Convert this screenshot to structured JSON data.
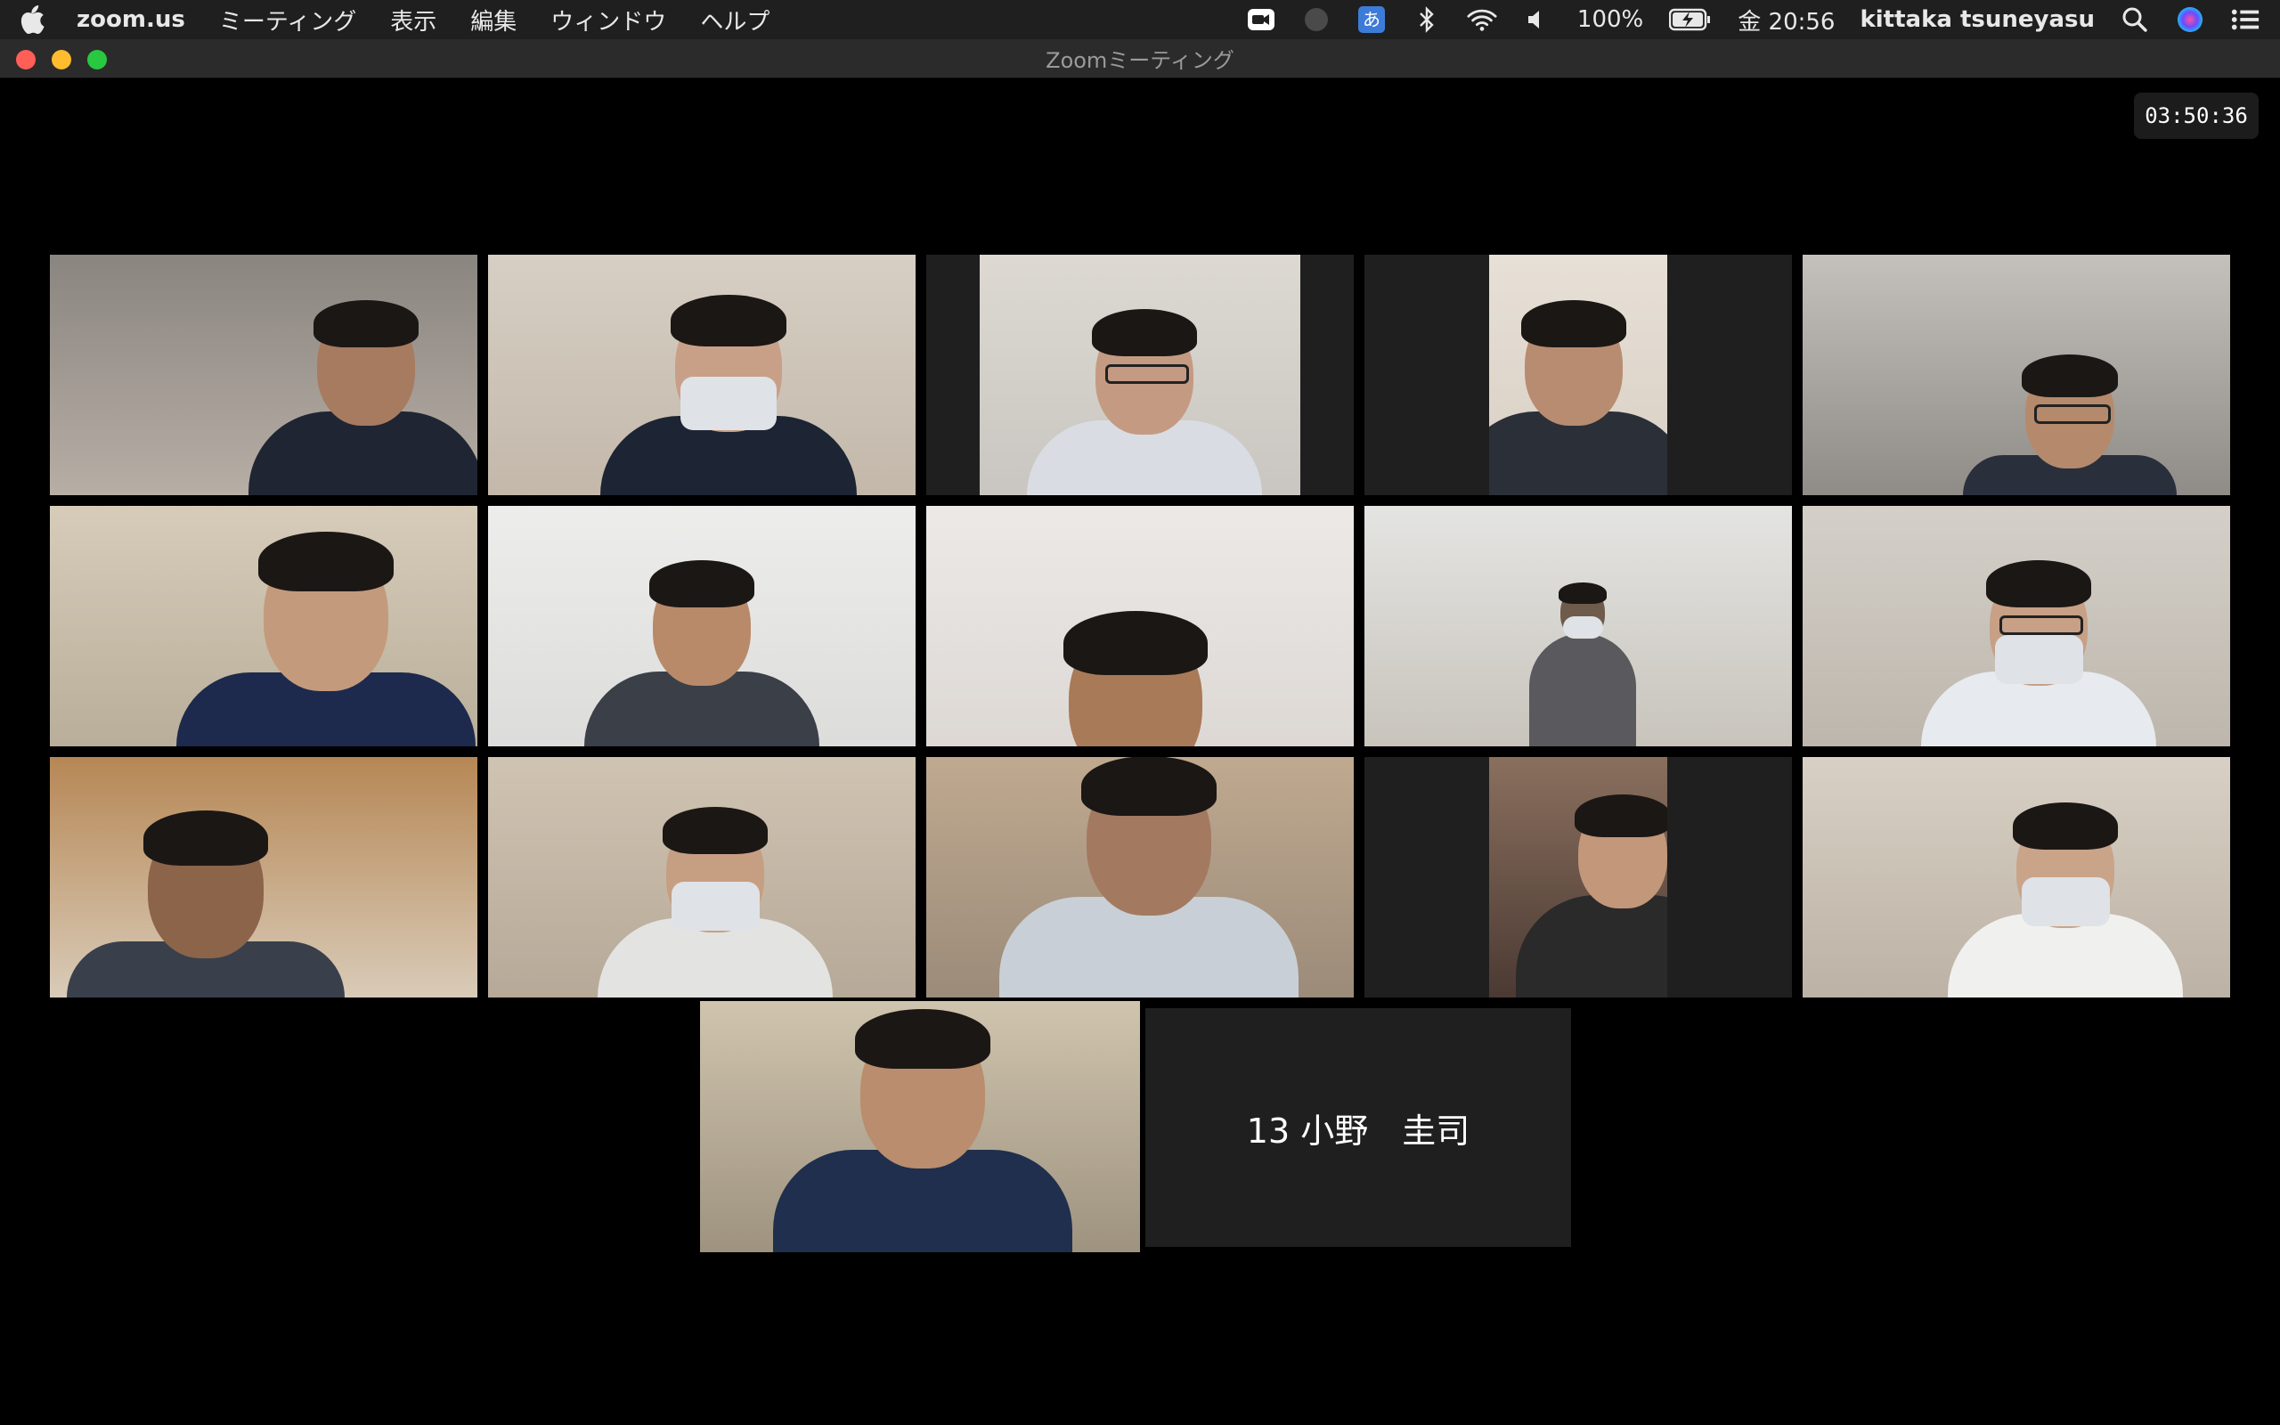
{
  "menubar": {
    "app_name": "zoom.us",
    "menus": [
      "ミーティング",
      "表示",
      "編集",
      "ウィンドウ",
      "ヘルプ"
    ],
    "battery": "100%",
    "clock": "金 20:56",
    "user": "kittaka tsuneyasu",
    "ime_label": "あ"
  },
  "window": {
    "title": "Zoomミーティング",
    "timer": "03:50:36"
  },
  "participants": {
    "name_only_tile": "13 小野　圭司"
  },
  "colors": {
    "active_speaker_border": "#c9e08a",
    "tile_background": "#1f1f1f",
    "close": "#ff5f57",
    "minimize": "#febc2e",
    "zoom": "#28c840"
  }
}
